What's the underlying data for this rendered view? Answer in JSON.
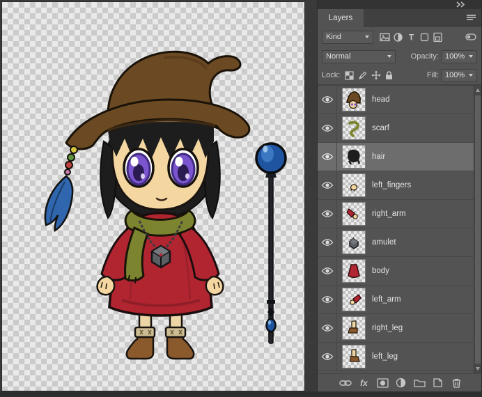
{
  "app": {
    "collapse_icon": "collapse-to-icons",
    "palette": {
      "panel_bg": "#535353",
      "panel_dark": "#404040",
      "selected_row_bg": "#6d6d6d",
      "text": "#dcdcdc",
      "hat_brown": "#6b4a23",
      "hat_band_olive": "#8d9030",
      "dress_red": "#b12531",
      "scarf_green": "#7d8430",
      "skin_tan": "#f4d6a0",
      "hair_black": "#1e1d1e",
      "eye_purple": "#7b54cf",
      "staff_orb_blue": "#1f55a0",
      "boot_brown": "#8a5a2c"
    }
  },
  "canvas": {
    "content": "chibi witch character and blue orb staff on transparent checkerboard"
  },
  "layers_panel": {
    "tab_label": "Layers",
    "filter_row": {
      "kind_label": "Kind",
      "filter_icons": [
        "pixel-layer-filter-icon",
        "adjustment-layer-filter-icon",
        "type-layer-filter-icon",
        "shape-layer-filter-icon",
        "smart-object-filter-icon"
      ],
      "filter_toggle_icon": "layer-filter-toggle-icon"
    },
    "blend_row": {
      "blend_mode": "Normal",
      "opacity_label": "Opacity:",
      "opacity_value": "100%"
    },
    "lock_row": {
      "lock_label": "Lock:",
      "lock_icons": [
        "lock-transparent-pixels-icon",
        "lock-image-pixels-icon",
        "lock-position-icon",
        "lock-all-icon"
      ],
      "fill_label": "Fill:",
      "fill_value": "100%"
    },
    "layers": {
      "selected": "hair",
      "all_visible": true,
      "items": [
        {
          "name": "head"
        },
        {
          "name": "scarf"
        },
        {
          "name": "hair"
        },
        {
          "name": "left_fingers"
        },
        {
          "name": "right_arm"
        },
        {
          "name": "amulet"
        },
        {
          "name": "body"
        },
        {
          "name": "left_arm"
        },
        {
          "name": "right_leg"
        },
        {
          "name": "left_leg"
        }
      ]
    },
    "footer": {
      "fx_label": "fx",
      "icons": [
        "link-layers-icon",
        "layer-style-icon",
        "add-layer-mask-icon",
        "new-adjustment-layer-icon",
        "new-group-icon",
        "new-layer-icon",
        "delete-layer-icon"
      ]
    }
  }
}
